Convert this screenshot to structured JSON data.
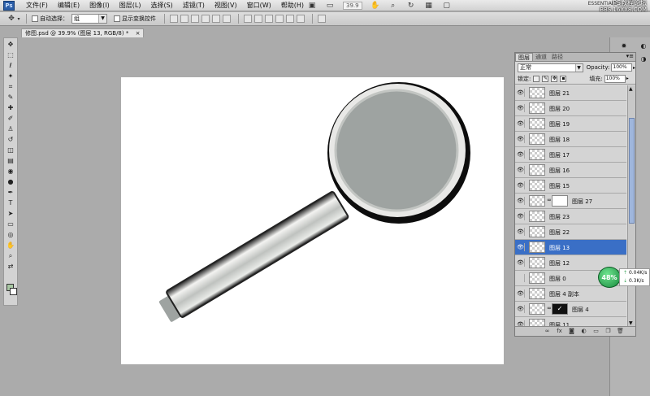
{
  "app": {
    "logo_text": "Ps"
  },
  "menu": [
    "文件(F)",
    "编辑(E)",
    "图像(I)",
    "图层(L)",
    "选择(S)",
    "滤镜(T)",
    "视图(V)",
    "窗口(W)",
    "帮助(H)"
  ],
  "app_bar": {
    "zoom": "39.9",
    "workspace": "ESSENTIALS"
  },
  "watermark": {
    "line1": "PS教程论坛",
    "line2": "BBS.16XX8.COM"
  },
  "options": {
    "auto_select_label": "自动选择：",
    "auto_select_value": "组",
    "show_transform_label": "显示变换控件"
  },
  "document_tab": {
    "title": "修图.psd @ 39.9% (图层 13, RGB/8) *",
    "close": "×"
  },
  "colors": {
    "foreground": "#a8c7a3",
    "background": "#ffffff",
    "selected_layer": "#3a6fc6"
  },
  "layers_panel": {
    "tabs": [
      "图层",
      "通道",
      "路径"
    ],
    "blend_mode": "正常",
    "opacity_label": "Opacity:",
    "opacity_value": "100%",
    "lock_label": "锁定:",
    "fill_label": "填充:",
    "fill_value": "100%",
    "layers": [
      {
        "name": "图层 21",
        "visible": true
      },
      {
        "name": "图层 20",
        "visible": true
      },
      {
        "name": "图层 19",
        "visible": true
      },
      {
        "name": "图层 18",
        "visible": true
      },
      {
        "name": "图层 17",
        "visible": true
      },
      {
        "name": "图层 16",
        "visible": true
      },
      {
        "name": "图层 15",
        "visible": true
      },
      {
        "name": "图层 27",
        "visible": true,
        "mask": "white"
      },
      {
        "name": "图层 23",
        "visible": true
      },
      {
        "name": "图层 22",
        "visible": true
      },
      {
        "name": "图层 13",
        "visible": true,
        "selected": true
      },
      {
        "name": "图层 12",
        "visible": true
      },
      {
        "name": "图层 0",
        "visible": false
      },
      {
        "name": "图层 4 副本",
        "visible": true
      },
      {
        "name": "图层 4",
        "visible": true,
        "mask": "black"
      },
      {
        "name": "图层 11",
        "visible": true
      }
    ]
  },
  "net_monitor": {
    "percent": "48%",
    "up": "0.04K/s",
    "down": "0.3K/s"
  }
}
